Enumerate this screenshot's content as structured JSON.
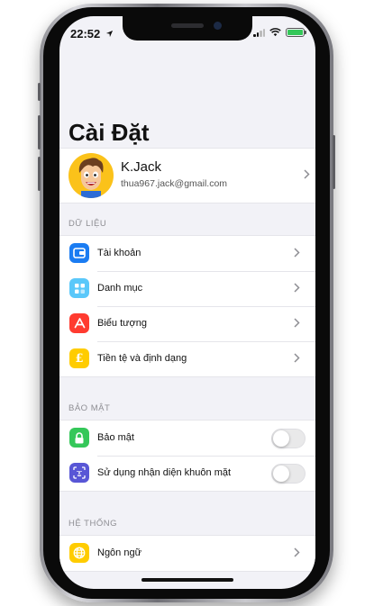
{
  "status_bar": {
    "time": "22:52"
  },
  "page": {
    "title": "Cài Đặt"
  },
  "profile": {
    "name": "K.Jack",
    "email": "thua967.jack@gmail.com"
  },
  "sections": {
    "data": {
      "label": "DỮ LIỆU",
      "items": [
        {
          "label": "Tài khoản",
          "icon": "wallet-icon",
          "color": "#1a7cf2"
        },
        {
          "label": "Danh mục",
          "icon": "category-icon",
          "color": "#5ac8fa"
        },
        {
          "label": "Biểu tượng",
          "icon": "app-store-icon",
          "color": "#ff3b30"
        },
        {
          "label": "Tiền tệ và định dạng",
          "icon": "pound-currency-icon",
          "color": "#ffcc00"
        }
      ]
    },
    "security": {
      "label": "BẢO MẬT",
      "items": [
        {
          "label": "Bảo mật",
          "icon": "lock-icon",
          "color": "#34c759",
          "toggle_on": false
        },
        {
          "label": "Sử dụng nhận diện khuôn mặt",
          "icon": "face-id-icon",
          "color": "#5856d6",
          "toggle_on": false
        }
      ]
    },
    "system": {
      "label": "HỆ THỐNG",
      "items": [
        {
          "label": "Ngôn ngữ",
          "icon": "globe-icon",
          "color": "#ffcc00"
        }
      ]
    }
  }
}
